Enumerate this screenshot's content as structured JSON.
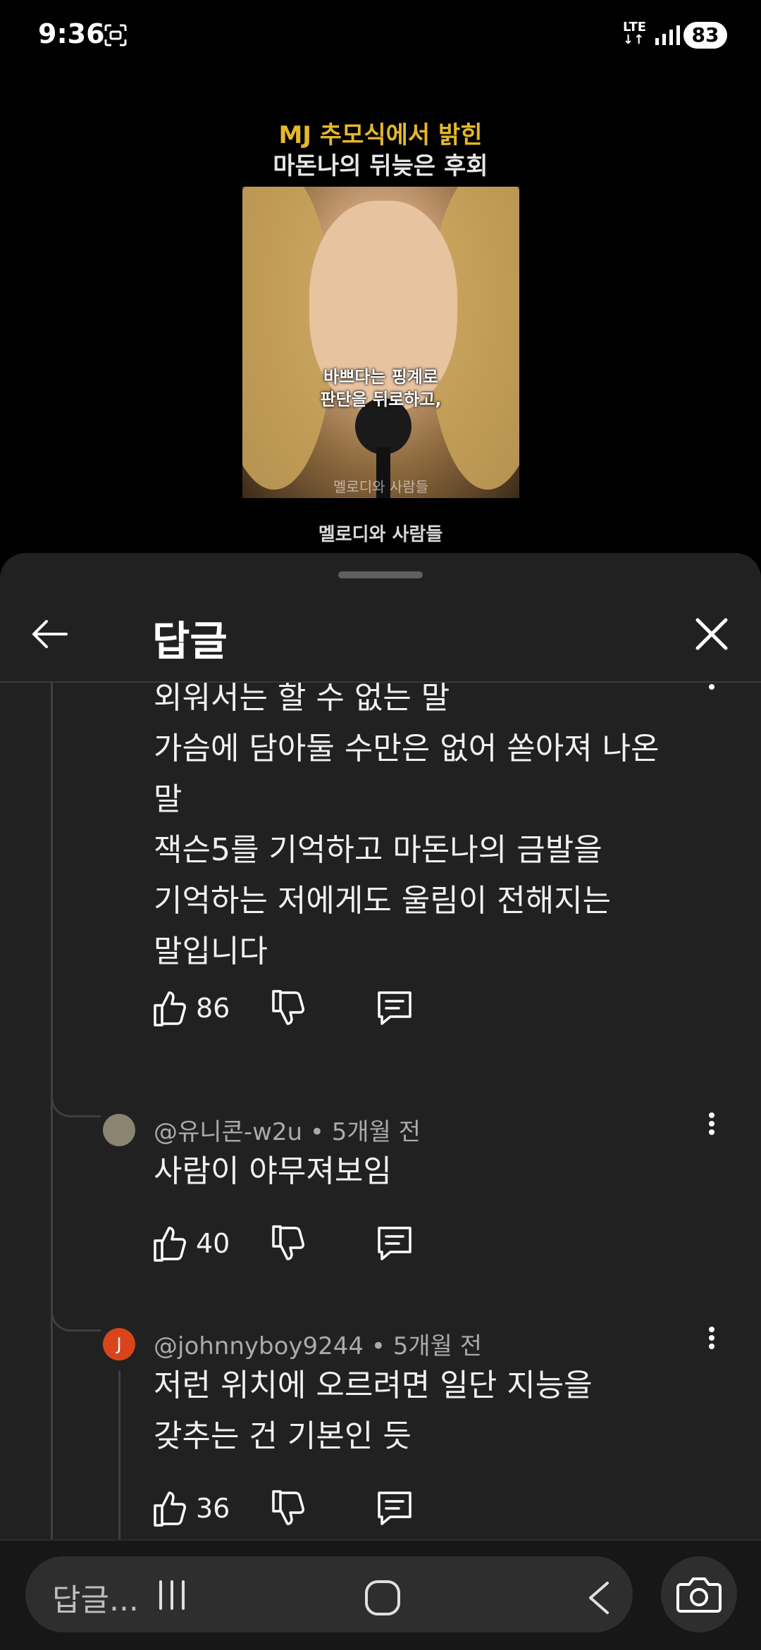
{
  "status": {
    "time": "9:36",
    "network": "LTE",
    "battery": "83"
  },
  "video": {
    "title_line1": "MJ 추모식에서 밝힌",
    "title_line2": "마돈나의 뒤늦은 후회",
    "caption_line1": "바쁘다는 핑계로",
    "caption_line2": "판단을 뒤로하고,",
    "watermark": "멜로디와 사람들",
    "channel": "멜로디와 사람들"
  },
  "sheet": {
    "title": "답글"
  },
  "replies": [
    {
      "lines": [
        "외워서는 할 수 없는 말",
        "가슴에 담아둘 수만은 없어 쏟아져 나온",
        "말",
        "잭슨5를 기억하고 마돈나의 금발을",
        "기억하는 저에게도 울림이 전해지는",
        "말입니다"
      ],
      "likes": "86"
    },
    {
      "author": "@유니콘-w2u • 5개월 전",
      "lines": [
        "사람이 야무져보임"
      ],
      "likes": "40"
    },
    {
      "author": "@johnnyboy9244 • 5개월 전",
      "avatar_letter": "J",
      "lines": [
        "저런 위치에 오르려면 일단 지능을",
        "갖추는 건 기본인 듯"
      ],
      "likes": "36"
    }
  ],
  "composer": {
    "placeholder": "답글..."
  },
  "colors": {
    "sheet_bg": "#212121",
    "accent_gold": "#e5b82a",
    "avatar_j": "#d9441b"
  }
}
